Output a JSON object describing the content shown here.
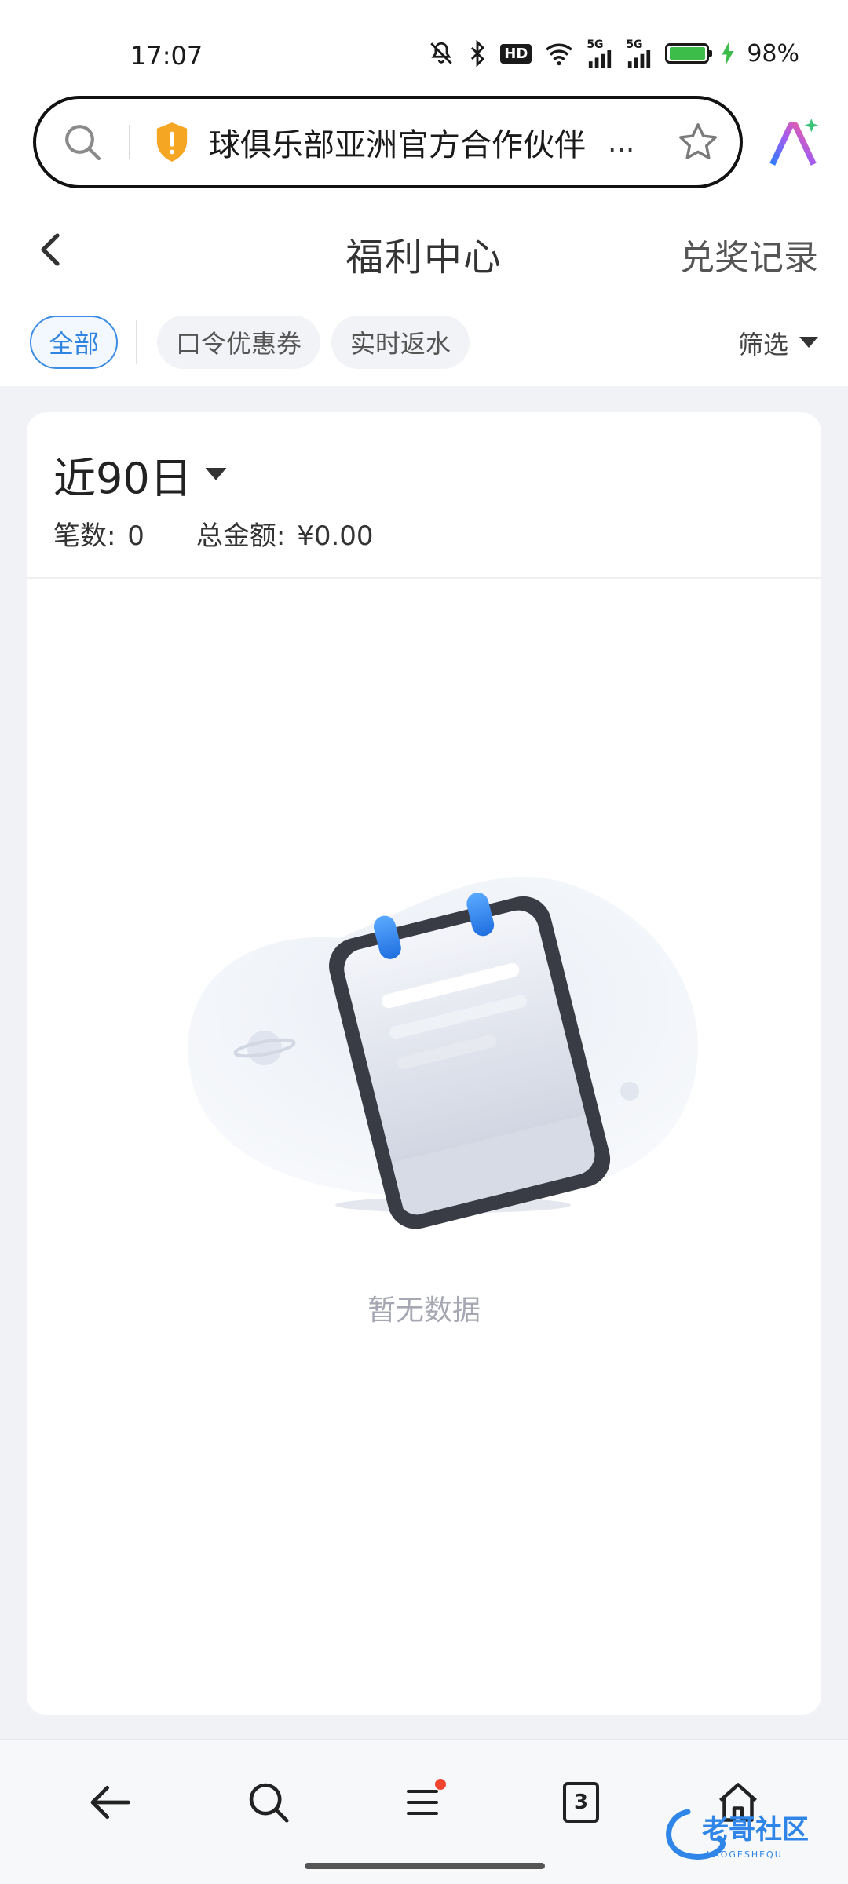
{
  "status_bar": {
    "time": "17:07",
    "battery_percent": "98%",
    "battery_level": 0.98,
    "hd_label": "HD",
    "signal_labels": [
      "5G",
      "5G"
    ],
    "icons": [
      "mute-icon",
      "bluetooth-icon",
      "hd-icon",
      "wifi-icon",
      "signal-5g-icon",
      "signal-5g-icon",
      "battery-icon",
      "charging-icon"
    ]
  },
  "browser": {
    "url_title": "球俱乐部亚洲官方合作伙伴",
    "ellipsis": "...",
    "icons": [
      "search-icon",
      "security-shield-icon",
      "star-icon",
      "ai-icon"
    ]
  },
  "header": {
    "title": "福利中心",
    "right_link": "兑奖记录",
    "back_icon": "back-chevron-icon"
  },
  "tabs": {
    "items": [
      {
        "label": "全部",
        "active": true
      },
      {
        "label": "口令优惠券",
        "active": false
      },
      {
        "label": "实时返水",
        "active": false
      }
    ],
    "filter_label": "筛选"
  },
  "summary": {
    "period": "近90日",
    "count_label": "笔数:",
    "count_value": "0",
    "amount_label": "总金额:",
    "amount_value": "¥0.00"
  },
  "empty_state": {
    "text": "暂无数据"
  },
  "bottom_nav": {
    "tab_count": "3",
    "icons": [
      "back-arrow-icon",
      "search-icon",
      "menu-icon",
      "tabs-icon",
      "home-icon"
    ]
  },
  "watermark": {
    "text": "老哥社区",
    "sub": "LAOGESHEQU"
  },
  "colors": {
    "accent": "#2e84e0",
    "background": "#f1f2f6",
    "badge": "#f0442f",
    "battery": "#3cbd4a",
    "shield": "#f5a623"
  }
}
